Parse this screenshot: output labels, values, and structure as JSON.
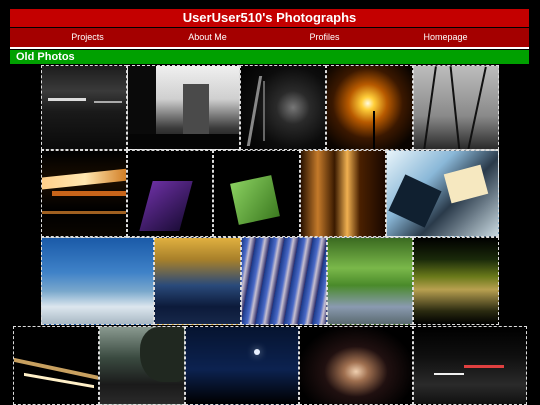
{
  "header": {
    "title": "UserUser510's Photographs"
  },
  "nav": {
    "items": [
      {
        "label": "Projects"
      },
      {
        "label": "About Me"
      },
      {
        "label": "Profiles"
      },
      {
        "label": "Homepage"
      }
    ]
  },
  "section": {
    "title": "Old Photos"
  },
  "colors": {
    "title_bg": "#c40000",
    "nav_bg": "#a40000",
    "section_bg": "#00a000",
    "page_bg": "#000000"
  },
  "photos": [
    {
      "row": 1,
      "icon": "photo-dark-street-light-trails"
    },
    {
      "row": 1,
      "icon": "photo-building-silhouette"
    },
    {
      "row": 1,
      "icon": "photo-dark-light-streaks"
    },
    {
      "row": 1,
      "icon": "photo-streetlamp-glow"
    },
    {
      "row": 1,
      "icon": "photo-bare-branches"
    },
    {
      "row": 2,
      "icon": "photo-orange-light-streaks"
    },
    {
      "row": 2,
      "icon": "photo-purple-light-shape"
    },
    {
      "row": 2,
      "icon": "photo-green-light-shape"
    },
    {
      "row": 2,
      "icon": "photo-amber-light-bars"
    },
    {
      "row": 2,
      "icon": "photo-abstract-collage"
    },
    {
      "row": 3,
      "icon": "photo-frozen-sea"
    },
    {
      "row": 3,
      "icon": "photo-golden-water"
    },
    {
      "row": 3,
      "icon": "photo-blue-ripple-texture"
    },
    {
      "row": 3,
      "icon": "photo-blurred-garden-path"
    },
    {
      "row": 3,
      "icon": "photo-trees-reflection"
    },
    {
      "row": 4,
      "icon": "photo-night-road-lights"
    },
    {
      "row": 4,
      "icon": "photo-night-trees"
    },
    {
      "row": 4,
      "icon": "photo-night-sky-light"
    },
    {
      "row": 4,
      "icon": "photo-glowing-dome"
    },
    {
      "row": 4,
      "icon": "photo-night-traffic"
    }
  ]
}
